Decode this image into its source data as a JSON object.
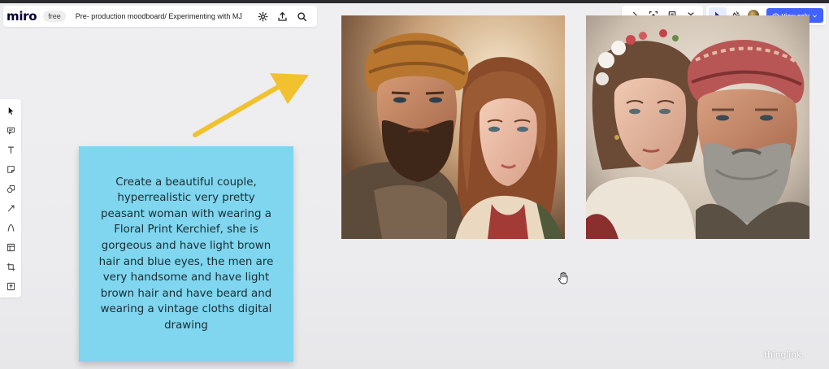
{
  "app": {
    "logo": "miro",
    "plan_badge": "free",
    "board_title": "Pre- production moodboard/ Experimenting with MJ"
  },
  "header_icons": [
    "settings-icon",
    "upload-icon",
    "search-icon"
  ],
  "right_toolbar": {
    "icons": [
      "chevron-right-icon",
      "focus-icon",
      "notes-icon",
      "chevron-down-icon"
    ],
    "icons2": [
      "cursor-select-icon",
      "reactions-icon"
    ],
    "view_button_label": "View only",
    "accent": "#4262ff"
  },
  "left_toolbar": {
    "tools": [
      "select-tool-icon",
      "sticky-comment-icon",
      "text-tool-icon",
      "sticky-note-icon",
      "shapes-icon",
      "connection-line-icon",
      "pen-icon",
      "frame-templates-icon",
      "crop-frame-icon",
      "upload-tool-icon"
    ]
  },
  "sticky_note": {
    "text": "Create a beautiful couple, hyperrealistic very pretty peasant woman with wearing a Floral Print Kerchief, she is gorgeous and have light brown hair and blue eyes, the men are very handsome and have light brown hair and have beard and wearing a vintage cloths digital drawing",
    "color": "#7fd6ee"
  },
  "arrow": {
    "color": "#f2c12e"
  },
  "images": [
    {
      "name": "couple-image-1"
    },
    {
      "name": "couple-image-2"
    }
  ],
  "watermark": "thinglink."
}
